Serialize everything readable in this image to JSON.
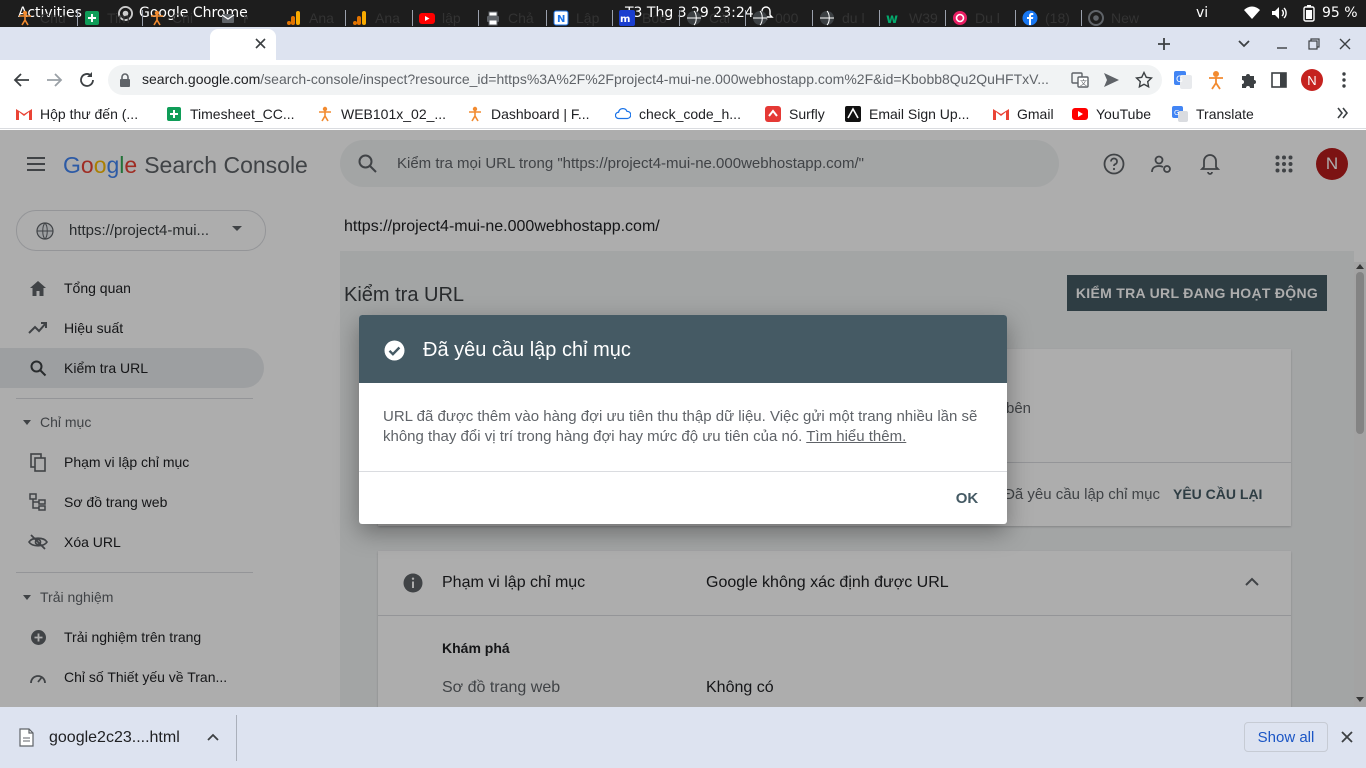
{
  "os_bar": {
    "activities": "Activities",
    "app_name": "Google Chrome",
    "datetime": "T3 Thg 3 29  23:24",
    "lang": "vi",
    "battery": "95 %"
  },
  "tabs": [
    {
      "label": "Chu"
    },
    {
      "label": "Tim"
    },
    {
      "label": "Chi"
    },
    {
      "label": "K"
    },
    {
      "label": "Ana"
    },
    {
      "label": "Ana"
    },
    {
      "label": "lập"
    },
    {
      "label": "Chả"
    },
    {
      "label": "Lập"
    },
    {
      "label": "Boo"
    },
    {
      "label": "Cài"
    },
    {
      "label": "000"
    },
    {
      "label": "du l"
    },
    {
      "label": "W39"
    },
    {
      "label": "Du l"
    },
    {
      "label": "(18)"
    },
    {
      "label": "New"
    }
  ],
  "address_bar": {
    "url_host": "search.google.com",
    "url_rest": "/search-console/inspect?resource_id=https%3A%2F%2Fproject4-mui-ne.000webhostapp.com%2F&id=Kbobb8Qu2QuHFTxV...",
    "profile_initial": "N"
  },
  "bookmarks": [
    {
      "label": "Hộp thư đến (..."
    },
    {
      "label": "Timesheet_CC..."
    },
    {
      "label": "WEB101x_02_..."
    },
    {
      "label": "Dashboard | F..."
    },
    {
      "label": "check_code_h..."
    },
    {
      "label": "Surfly"
    },
    {
      "label": "Email Sign Up..."
    },
    {
      "label": "Gmail"
    },
    {
      "label": "YouTube"
    },
    {
      "label": "Translate"
    }
  ],
  "header": {
    "logo_google": "Google",
    "logo_product": "Search Console",
    "search_placeholder": "Kiểm tra mọi URL trong \"https://project4-mui-ne.000webhostapp.com/\"",
    "avatar_initial": "N"
  },
  "sidebar": {
    "property": "https://project4-mui...",
    "items": [
      {
        "label": "Tổng quan"
      },
      {
        "label": "Hiệu suất"
      },
      {
        "label": "Kiểm tra URL"
      }
    ],
    "section_index": "Chỉ mục",
    "index_items": [
      {
        "label": "Phạm vi lập chỉ mục"
      },
      {
        "label": "Sơ đồ trang web"
      },
      {
        "label": "Xóa URL"
      }
    ],
    "section_experience": "Trải nghiệm",
    "experience_items": [
      {
        "label": "Trải nghiệm trên trang"
      },
      {
        "label": "Chỉ số Thiết yếu về Tran..."
      }
    ]
  },
  "main": {
    "site_url": "https://project4-mui-ne.000webhostapp.com/",
    "title": "Kiểm tra URL",
    "test_live_button": "KIỂM TRA URL ĐANG HOẠT ĐỘNG",
    "partial_text": "bên",
    "request_status": "Đã yêu cầu lập chỉ mục",
    "request_again_button": "YÊU CẦU LẠI",
    "coverage": {
      "label": "Phạm vi lập chỉ mục",
      "value": "Google không xác định được URL",
      "discovery_title": "Khám phá",
      "sitemap_label": "Sơ đồ trang web",
      "sitemap_value": "Không có"
    }
  },
  "dialog": {
    "title": "Đã yêu cầu lập chỉ mục",
    "body": "URL đã được thêm vào hàng đợi ưu tiên thu thập dữ liệu. Việc gửi một trang nhiều lần sẽ không thay đổi vị trí trong hàng đợi hay mức độ ưu tiên của nó.",
    "learn_more": "Tìm hiểu thêm.",
    "ok": "OK"
  },
  "download_bar": {
    "filename": "google2c23....html",
    "show_all": "Show all"
  },
  "colors": {
    "dialog_header": "#455a64",
    "active_nav": "#e8eaed",
    "avatar": "#b71c1c",
    "link_blue": "#1a73e8"
  }
}
